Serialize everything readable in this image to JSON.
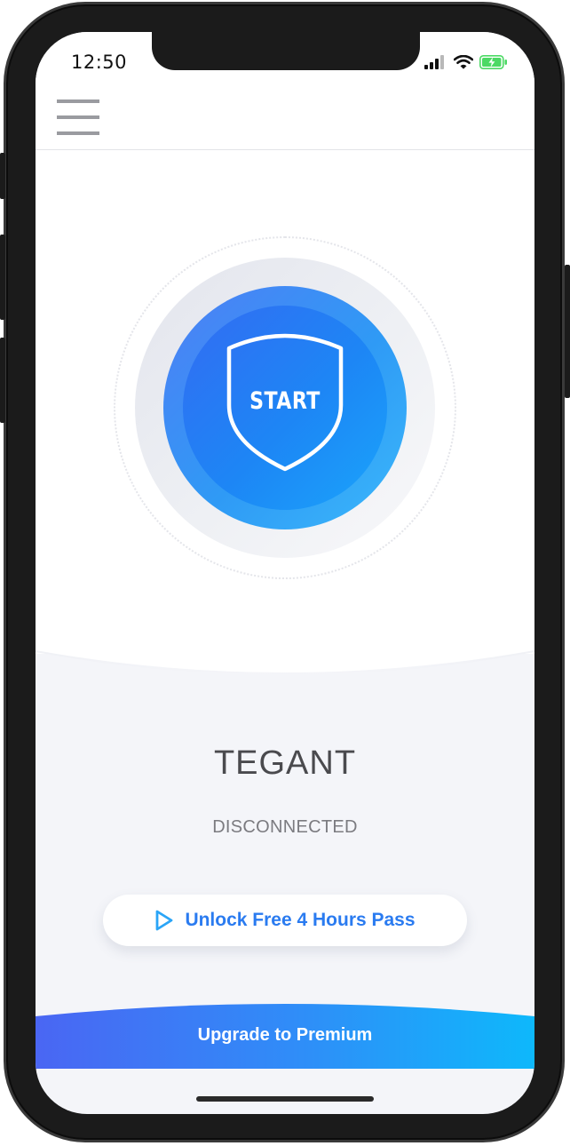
{
  "status_bar": {
    "time": "12:50"
  },
  "colors": {
    "accent_blue": "#2a7bf0",
    "start_gradient_start": "#4f7ef5",
    "start_gradient_end": "#3bb8fb",
    "upgrade_gradient_start": "#4a66f3",
    "upgrade_gradient_end": "#0eb8fb",
    "battery_green": "#4cd964"
  },
  "header": {
    "menu_icon": "hamburger-menu-icon"
  },
  "connect_button": {
    "label": "START",
    "icon": "shield-icon"
  },
  "server": {
    "name": "TEGANT"
  },
  "connection": {
    "status": "DISCONNECTED"
  },
  "unlock_pass": {
    "label": "Unlock Free 4 Hours Pass",
    "icon": "play-icon"
  },
  "upgrade": {
    "label": "Upgrade to Premium"
  }
}
